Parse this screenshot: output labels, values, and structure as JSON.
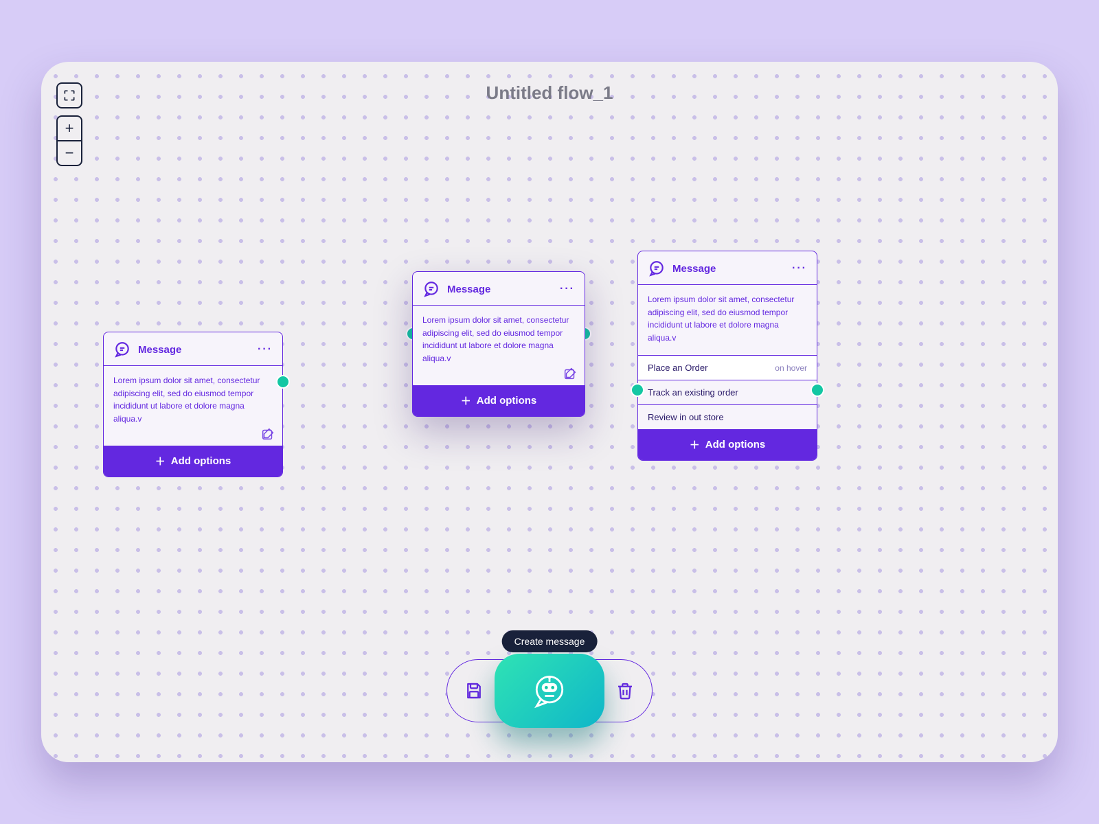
{
  "title": "Untitled flow_1",
  "tooltip": "Create message",
  "add_options_label": "Add options",
  "cards": {
    "c1": {
      "title": "Message",
      "body": "Lorem ipsum dolor sit amet, consectetur adipiscing elit, sed do eiusmod tempor incididunt ut labore et dolore magna aliqua.v"
    },
    "c2": {
      "title": "Message",
      "body": "Lorem ipsum dolor sit amet, consectetur adipiscing elit, sed do eiusmod tempor incididunt ut labore et dolore magna aliqua.v"
    },
    "c3": {
      "title": "Message",
      "body": "Lorem ipsum dolor sit amet, consectetur adipiscing elit, sed do eiusmod tempor incididunt ut labore et dolore magna aliqua.v",
      "options": {
        "o1": {
          "label": "Place an Order",
          "hover": "on hover"
        },
        "o2": {
          "label": "Track an existing order"
        },
        "o3": {
          "label": "Review in out store"
        }
      }
    }
  },
  "icons": {
    "message": "message-icon",
    "menu": "more-icon",
    "edit": "edit-icon",
    "save": "save-icon",
    "trash": "trash-icon",
    "bot": "bot-icon",
    "fullscreen": "fullscreen-icon",
    "plus": "plus-icon",
    "minus": "minus-icon"
  }
}
